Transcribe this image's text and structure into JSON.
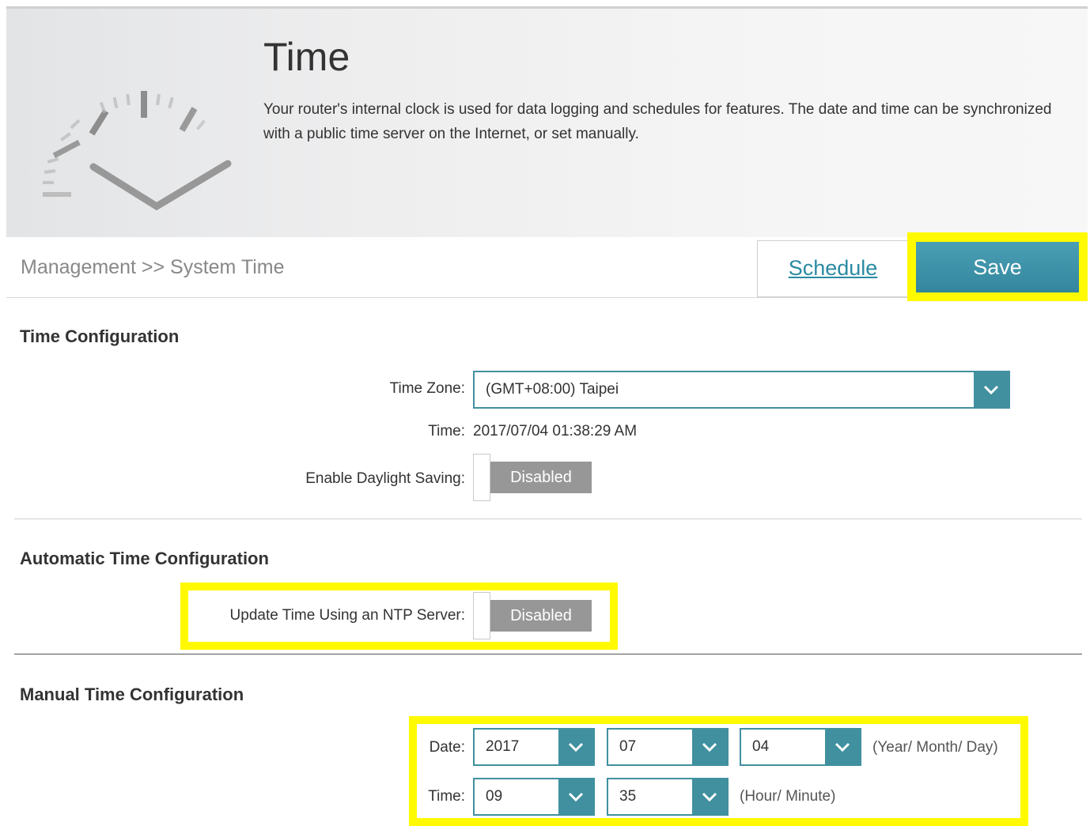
{
  "header": {
    "title": "Time",
    "description": "Your router's internal clock is used for data logging and schedules for features. The date and time can be synchronized with a public time server on the Internet, or set manually."
  },
  "breadcrumb": "Management >> System Time",
  "actions": {
    "schedule_label": "Schedule",
    "save_label": "Save"
  },
  "time_config": {
    "heading": "Time Configuration",
    "timezone_label": "Time Zone:",
    "timezone_value": "(GMT+08:00) Taipei",
    "time_label": "Time:",
    "time_value": "2017/07/04 01:38:29 AM",
    "daylight_label": "Enable Daylight Saving:",
    "daylight_state": "Disabled"
  },
  "auto_config": {
    "heading": "Automatic Time Configuration",
    "ntp_label": "Update Time Using an NTP Server:",
    "ntp_state": "Disabled"
  },
  "manual_config": {
    "heading": "Manual Time Configuration",
    "date_label": "Date:",
    "year": "2017",
    "month": "07",
    "day": "04",
    "date_hint": "(Year/ Month/ Day)",
    "time_label": "Time:",
    "hour": "09",
    "minute": "35",
    "time_hint": "(Hour/ Minute)"
  },
  "colors": {
    "accent": "#40909f",
    "highlight": "#fffa00",
    "toggle_off": "#979797"
  },
  "icons": {
    "dropdown": "chevron-down-icon",
    "header_art": "clock-icon"
  }
}
